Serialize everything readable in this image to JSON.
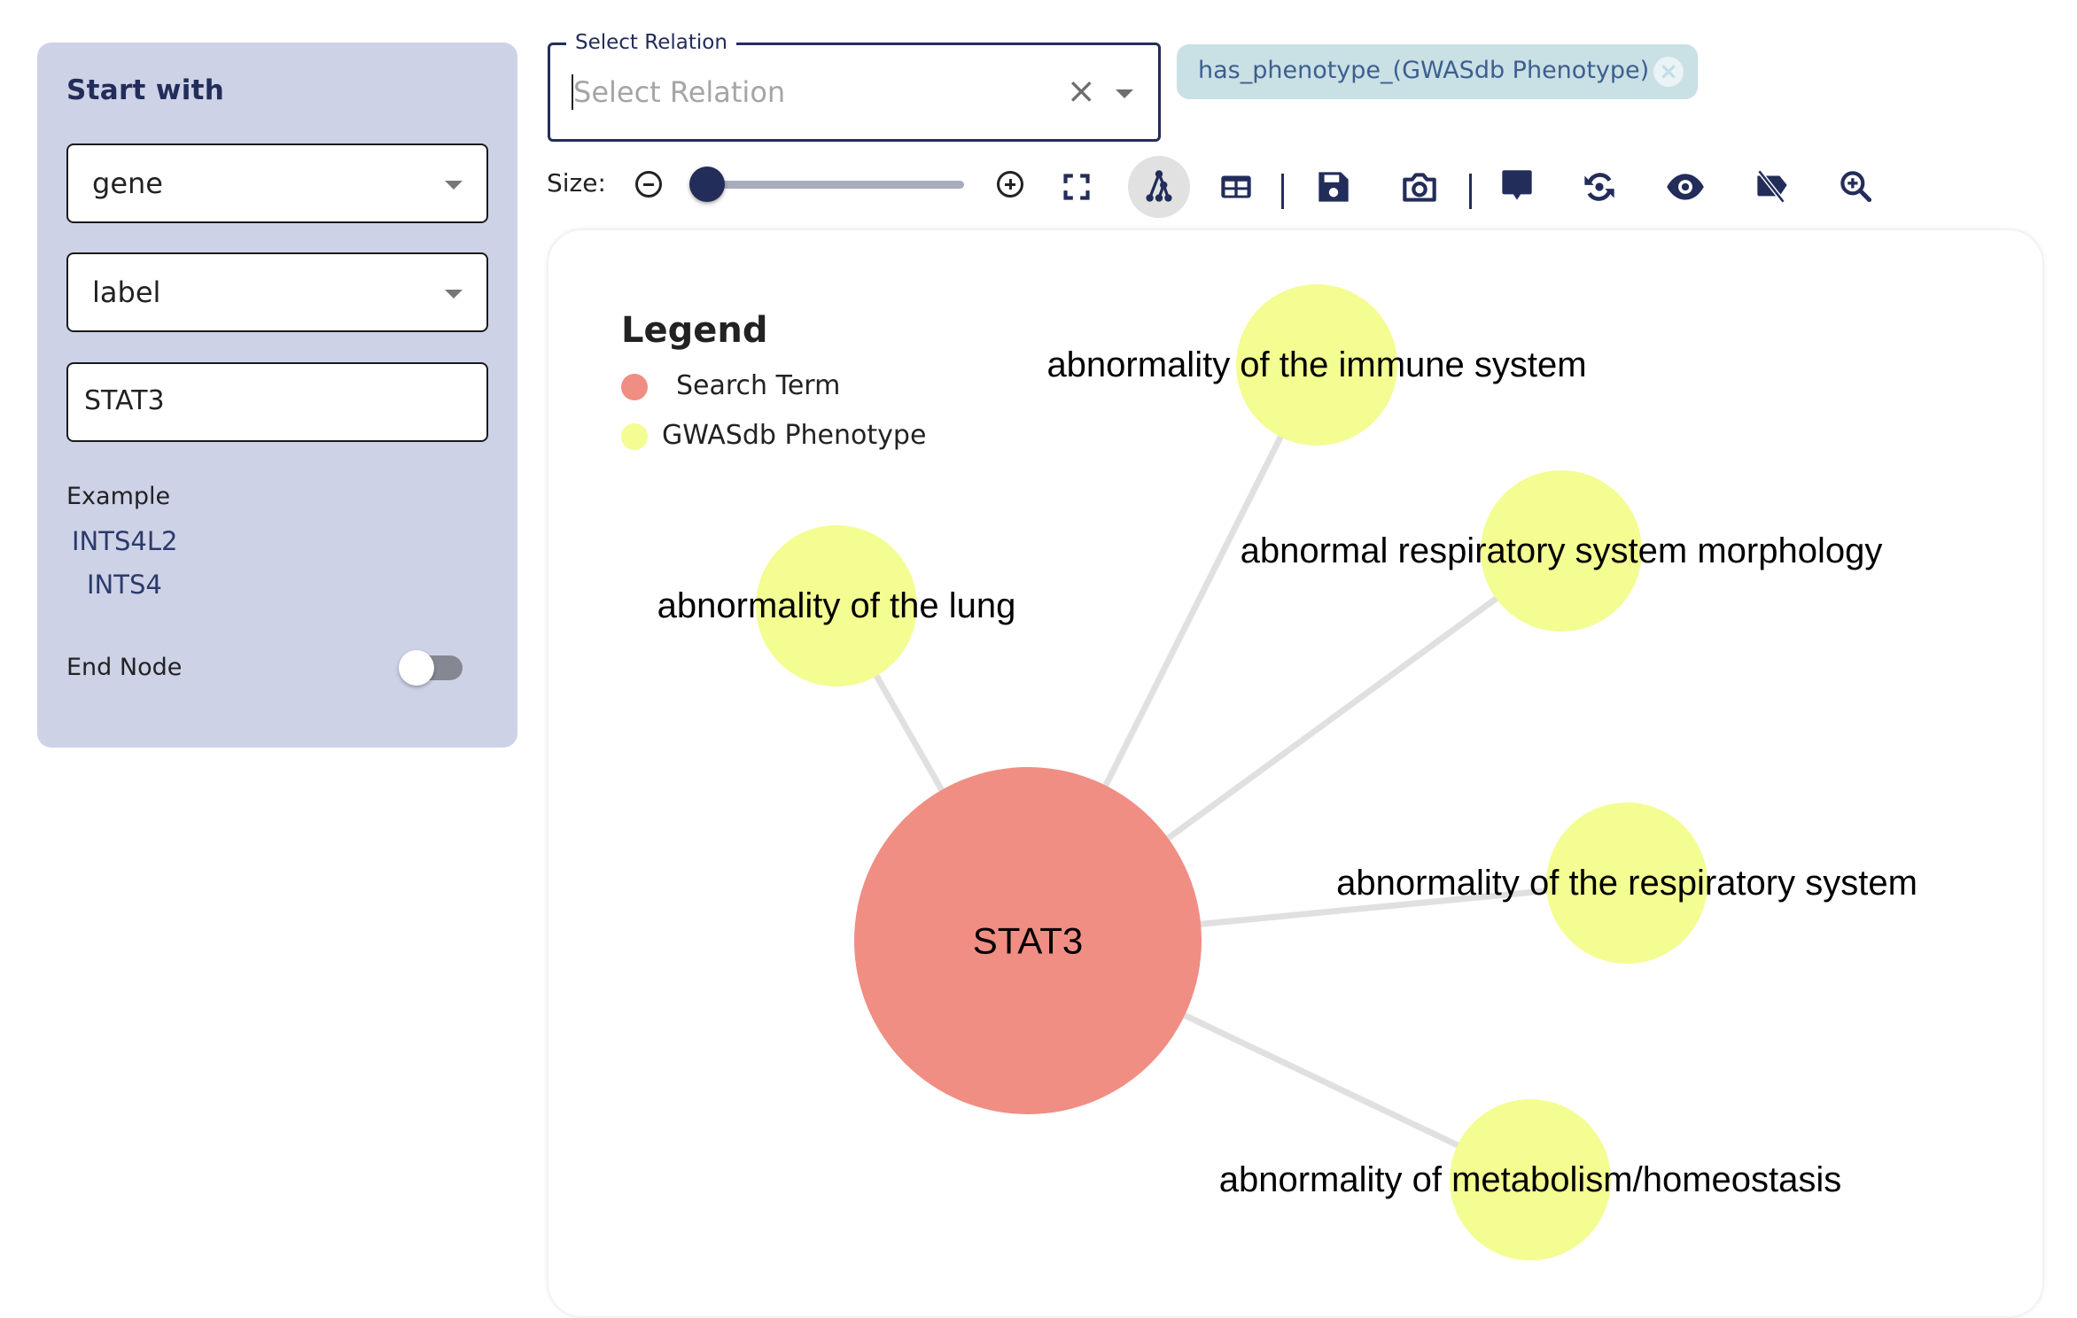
{
  "left_panel": {
    "title": "Start with",
    "node_type_select": {
      "value": "gene"
    },
    "property_select": {
      "value": "label"
    },
    "search_input": {
      "value": "STAT3"
    },
    "example_label": "Example",
    "examples": [
      "INTS4L2",
      "INTS4"
    ],
    "end_node_label": "End Node",
    "end_node_enabled": false
  },
  "relation_select": {
    "label": "Select Relation",
    "placeholder": "Select Relation",
    "clear_icon": "×",
    "selected_chips": [
      {
        "label": "has_phenotype_(GWASdb Phenotype)",
        "close_icon": "×"
      }
    ]
  },
  "toolbar": {
    "size_label": "Size:",
    "size_slider_value_percent": 0,
    "icons": [
      "zoom-out-circle-icon",
      "zoom-in-circle-icon",
      "fullscreen-icon",
      "hierarchy-layout-icon",
      "table-icon",
      "save-icon",
      "camera-icon",
      "comment-icon",
      "sync-icon",
      "eye-icon",
      "label-off-icon",
      "magnify-plus-icon"
    ],
    "active_tool": "hierarchy-layout-icon"
  },
  "legend": {
    "title": "Legend",
    "items": [
      {
        "label": "Search Term",
        "color": "#f08e84"
      },
      {
        "label": "GWASdb Phenotype",
        "color": "#f3fd91"
      }
    ]
  },
  "graph": {
    "center_node": {
      "id": "STAT3",
      "label": "STAT3",
      "type": "Search Term",
      "color": "#f08e84"
    },
    "edge_color": "#e0e0e0",
    "nodes": [
      {
        "id": "immune",
        "label": "abnormality of the immune system",
        "type": "GWASdb Phenotype",
        "color": "#f3fd91"
      },
      {
        "id": "resp_morph",
        "label": "abnormal respiratory system morphology",
        "type": "GWASdb Phenotype",
        "color": "#f3fd91"
      },
      {
        "id": "lung",
        "label": "abnormality of the lung",
        "type": "GWASdb Phenotype",
        "color": "#f3fd91"
      },
      {
        "id": "resp_sys",
        "label": "abnormality of the respiratory system",
        "type": "GWASdb Phenotype",
        "color": "#f3fd91"
      },
      {
        "id": "metab",
        "label": "abnormality of metabolism/homeostasis",
        "type": "GWASdb Phenotype",
        "color": "#f3fd91"
      }
    ],
    "edges": [
      {
        "source": "STAT3",
        "target": "immune"
      },
      {
        "source": "STAT3",
        "target": "resp_morph"
      },
      {
        "source": "STAT3",
        "target": "lung"
      },
      {
        "source": "STAT3",
        "target": "resp_sys"
      },
      {
        "source": "STAT3",
        "target": "metab"
      }
    ]
  }
}
